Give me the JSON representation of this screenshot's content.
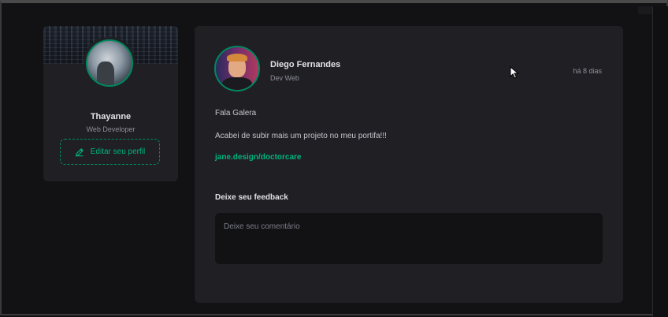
{
  "sidebar": {
    "profile_name": "Thayanne",
    "profile_role": "Web Developer",
    "edit_label": "Editar seu perfil"
  },
  "post": {
    "author": {
      "name": "Diego Fernandes",
      "role": "Dev Web"
    },
    "time": "há 8 dias",
    "content": {
      "greeting": "Fala Galera",
      "message": "Acabei de subir mais um projeto no meu portifa!!!",
      "link": "jane.design/doctorcare"
    },
    "feedback": {
      "title": "Deixe seu feedback",
      "placeholder": "Deixe seu comentário"
    }
  },
  "colors": {
    "background": "#121214",
    "card": "#202024",
    "accent": "#00b37e",
    "accent_border": "#00875f",
    "text_primary": "#e1e1e6",
    "text_secondary": "#8d8d99"
  },
  "icons": {
    "edit": "pencil-icon",
    "cursor": "mouse-pointer-icon"
  }
}
